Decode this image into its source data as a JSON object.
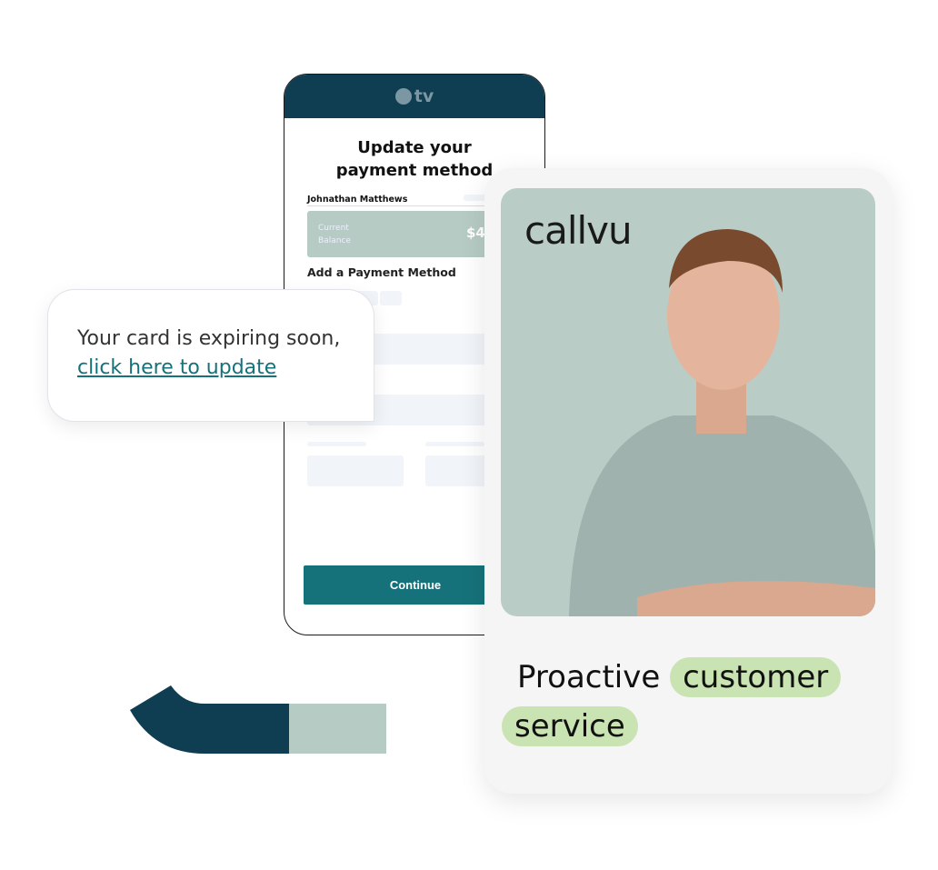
{
  "phone": {
    "logo": "tv",
    "title": "Update your payment method",
    "name": "Johnathan Matthews",
    "balance_label": "Current Balance",
    "balance_amount": "$4",
    "add_method": "Add a Payment Method",
    "continue": "Continue"
  },
  "bubble": {
    "text": "Your card is expiring soon,",
    "link": "click here to update"
  },
  "card": {
    "brand": "callvu",
    "tagline_plain": "Proactive",
    "tagline_hl1": "customer",
    "tagline_hl2": "service"
  },
  "colors": {
    "navy": "#0f3d51",
    "teal": "#16727a",
    "sage": "#b7cbc5",
    "highlight": "#c9e3b2"
  }
}
